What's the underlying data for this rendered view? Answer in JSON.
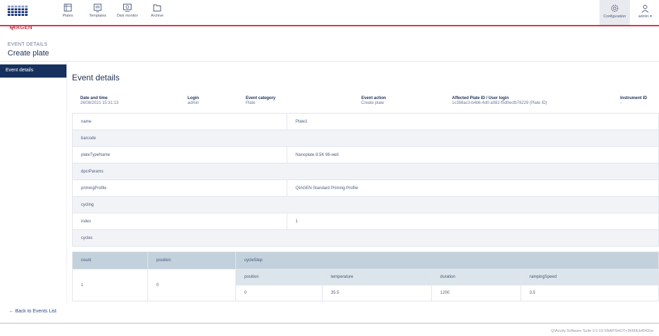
{
  "brand": {
    "name": "QIAGEN",
    "accent": "#d8344a",
    "navy": "#17315e"
  },
  "nav": [
    {
      "label": "Plates",
      "icon": "plates-icon"
    },
    {
      "label": "Templates",
      "icon": "templates-icon"
    },
    {
      "label": "Disk monitor",
      "icon": "disk-monitor-icon"
    },
    {
      "label": "Archive",
      "icon": "archive-icon"
    }
  ],
  "top_right": {
    "config_label": "Configuration",
    "admin_label": "admin ▾"
  },
  "header": {
    "crumb": "EVENT DETAILS",
    "title": "Create plate"
  },
  "sidebar": {
    "active_item": "Event details"
  },
  "main": {
    "section_title": "Event details",
    "meta": {
      "date_label": "Date and time",
      "date_value": "26/08/2021 15:31:13",
      "login_label": "Login",
      "login_value": "admin",
      "category_label": "Event category",
      "category_value": "Plate",
      "action_label": "Event action",
      "action_value": "Create plate",
      "affected_label": "Affected Plate ID / User login",
      "affected_value": "1c398ac3-b4b6-4d0-a082-f5d0ecfb78229 (Plate ID)",
      "instrument_label": "Instrument ID",
      "instrument_value": "-"
    },
    "props": {
      "name_key": "name",
      "name_val": "Plate1",
      "barcode_key": "barcode",
      "plateType_key": "plateTypeName",
      "plateType_val": "Nanoplate 8.5K 96-well",
      "dpcr_key": "dpcrParams",
      "priming_key": "primingProfile",
      "priming_val": "QIAGEN Standard Priming Profile",
      "cycling_key": "cycling",
      "index_key": "index",
      "index_val": "1",
      "cycles_key": "cycles"
    },
    "cycles": {
      "col_count": "count",
      "col_position": "position",
      "col_cycleStep": "cycleStep",
      "sub_position": "position",
      "sub_temperature": "temperature",
      "sub_duration": "duration",
      "sub_rampingSpeed": "rampingSpeed",
      "count_val": "1",
      "position_val": "0",
      "step_position": "0",
      "step_temperature": "35.5",
      "step_duration": "1200",
      "step_rampingSpeed": "3.5"
    }
  },
  "back_link": "← Back to Events List",
  "footer": "QIAcuity Software Suite 2.0.10-SNAPSHOT+3666fcb4542ce"
}
